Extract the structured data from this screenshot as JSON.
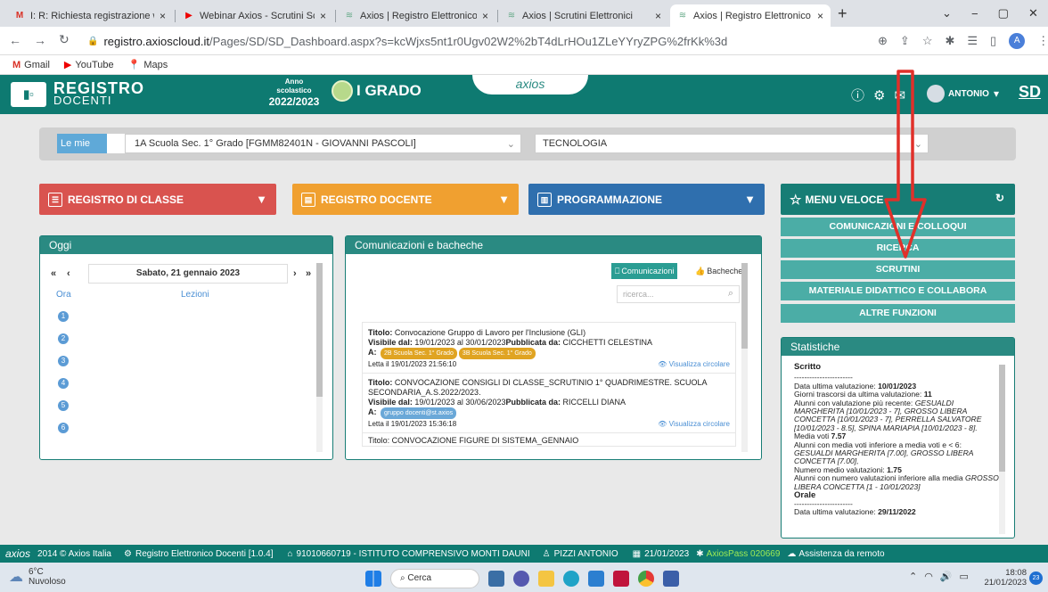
{
  "browser": {
    "tabs": [
      {
        "label": "I: R: Richiesta registrazione webir",
        "icon": "gmail-icon"
      },
      {
        "label": "Webinar Axios - Scrutini Scuola P",
        "icon": "youtube-icon"
      },
      {
        "label": "Axios | Registro Elettronico Doce",
        "icon": "axios-icon"
      },
      {
        "label": "Axios | Scrutini Elettronici",
        "icon": "axios-icon"
      },
      {
        "label": "Axios | Registro Elettronico Doce",
        "icon": "axios-icon"
      }
    ],
    "url_domain": "registro.axioscloud.it",
    "url_path": "/Pages/SD/SD_Dashboard.aspx?s=kcWjxs5nt1r0Ugv02W2%2bT4dLrHOu1ZLeYYryZPG%2frKk%3d",
    "bookmarks": [
      "Gmail",
      "YouTube",
      "Maps"
    ],
    "profile_initial": "A"
  },
  "header": {
    "logo_top": "REGISTRO",
    "logo_bottom": "DOCENTI",
    "year_label_1": "Anno",
    "year_label_2": "scolastico",
    "year_value": "2022/2023",
    "grade": "I GRADO",
    "brand": "axios",
    "user": "ANTONIO",
    "user_initials": "SD"
  },
  "selectors": {
    "le_mie": "Le mie",
    "school": "1A Scuola Sec. 1° Grado [FGMM82401N - GIOVANNI PASCOLI]",
    "subject": "TECNOLOGIA"
  },
  "main_buttons": {
    "registro_classe": "REGISTRO DI CLASSE",
    "registro_docente": "REGISTRO DOCENTE",
    "programmazione": "PROGRAMMAZIONE",
    "menu_veloce": "MENU VELOCE"
  },
  "oggi": {
    "title": "Oggi",
    "date": "Sabato, 21 gennaio 2023",
    "col_ora": "Ora",
    "col_lezioni": "Lezioni",
    "hours": [
      "1",
      "2",
      "3",
      "4",
      "5",
      "6"
    ]
  },
  "comunicazioni": {
    "title": "Comunicazioni e bacheche",
    "tab_comunicazioni": "Comunicazioni",
    "tab_bacheche": "Bacheche",
    "search_placeholder": "ricerca...",
    "items": [
      {
        "titolo_label": "Titolo:",
        "titolo": "Convocazione Gruppo di Lavoro per l'Inclusione (GLI)",
        "visibile_label": "Visibile dal:",
        "visibile": "19/01/2023 al 30/01/2023",
        "pubblicata_label": "Pubblicata da:",
        "pubblicata": "CICCHETTI CELESTINA",
        "a_label": "A:",
        "badges": [
          "2B Scuola Sec. 1° Grado",
          "3B Scuola Sec. 1° Grado"
        ],
        "letta": "Letta il 19/01/2023 21:56:10",
        "visualizza": "Visualizza circolare"
      },
      {
        "titolo_label": "Titolo:",
        "titolo": "CONVOCAZIONE CONSIGLI DI CLASSE_SCRUTINIO 1° QUADRIMESTRE. SCUOLA SECONDARIA_A.S.2022/2023.",
        "visibile_label": "Visibile dal:",
        "visibile": "19/01/2023 al 30/06/2023",
        "pubblicata_label": "Pubblicata da:",
        "pubblicata": "RICCELLI DIANA",
        "a_label": "A:",
        "badges": [
          "gruppo docenti@st.axios"
        ],
        "letta": "Letta il 19/01/2023 15:36:18",
        "visualizza": "Visualizza circolare"
      }
    ],
    "partial_next": "Titolo: CONVOCAZIONE FIGURE DI SISTEMA_GENNAIO"
  },
  "menu_veloce": {
    "items": [
      "COMUNICAZIONI E COLLOQUI",
      "RICERCA",
      "SCRUTINI",
      "MATERIALE DIDATTICO E COLLABORA",
      "ALTRE FUNZIONI"
    ]
  },
  "statistiche": {
    "title": "Statistiche",
    "scritto": "Scritto",
    "sep": "-----------------------",
    "data_ultima_label": "Data ultima valutazione:",
    "data_ultima": "10/01/2023",
    "giorni_label": "Giorni trascorsi da ultima valutazione:",
    "giorni": "11",
    "recente_label": "Alunni con valutazione più recente:",
    "recente": "GESUALDI MARGHERITA [10/01/2023 - 7], GROSSO LIBERA CONCETTA [10/01/2023 - 7], PERRELLA SALVATORE [10/01/2023 - 8.5], SPINA MARIAPIA [10/01/2023 - 8].",
    "media_label": "Media voti",
    "media": "7.57",
    "inferiore_label": "Alunni con media voti inferiore a media voti e < 6:",
    "inferiore": "GESUALDI MARGHERITA [7.00], GROSSO LIBERA CONCETTA [7.00],",
    "numero_medio_label": "Numero medio valutazioni:",
    "numero_medio": "1.75",
    "num_inferiore_label": "Alunni con numero valutazioni inferiore alla media",
    "num_inferiore": "GROSSO LIBERA CONCETTA [1 - 10/01/2023]",
    "orale": "Orale",
    "data_orale_label": "Data ultima valutazione:",
    "data_orale": "29/11/2022"
  },
  "footer": {
    "copyright": "2014 © Axios Italia",
    "version": "Registro Elettronico Docenti [1.0.4]",
    "school": "91010660719 - ISTITUTO COMPRENSIVO MONTI DAUNI",
    "teacher": "PIZZI ANTONIO",
    "date": "21/01/2023",
    "axiospass": "AxiosPass 020669",
    "assistenza": "Assistenza da remoto"
  },
  "taskbar": {
    "temp": "6°C",
    "weather": "Nuvoloso",
    "search": "Cerca",
    "time": "18:08",
    "date": "21/01/2023",
    "notifications": "23"
  },
  "colors": {
    "teal": "#0e7a71",
    "red": "#d9534f",
    "orange": "#f0a030",
    "blue": "#2f6fae",
    "arrow": "#e0302a"
  }
}
